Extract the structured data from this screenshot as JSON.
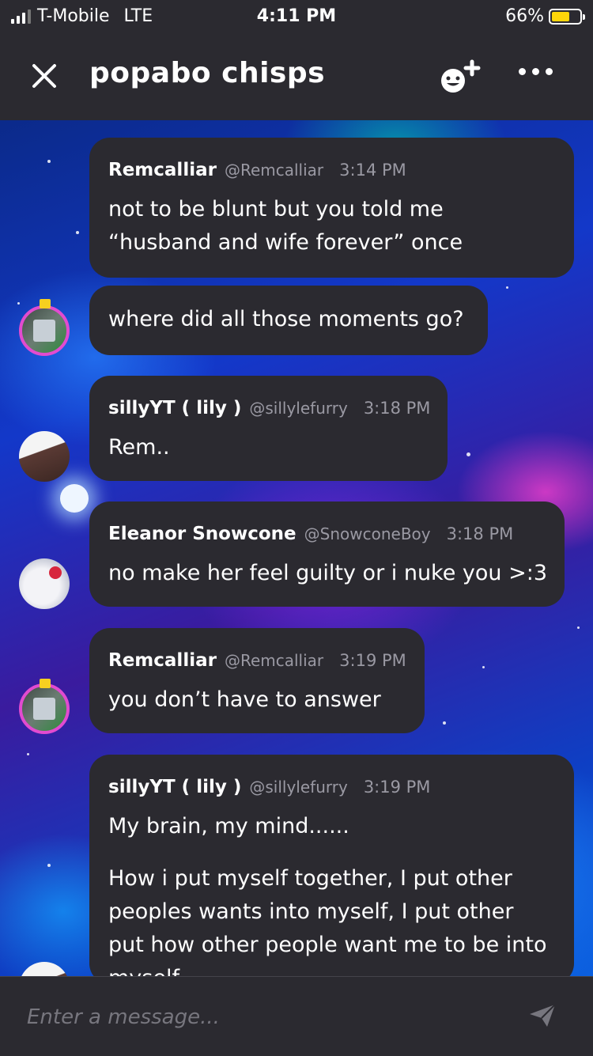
{
  "status_bar": {
    "carrier": "T-Mobile",
    "network": "LTE",
    "time": "4:11 PM",
    "battery": "66%"
  },
  "header": {
    "title": "popabo chisps"
  },
  "messages": [
    {
      "name": "Remcalliar",
      "handle": "@Remcalliar",
      "time": "3:14 PM",
      "text": "not to be blunt but you told me\n“husband and wife forever” once"
    },
    {
      "text": "where did all those moments go?"
    },
    {
      "name": "sillyYT ( lily )",
      "handle": "@sillylefurry",
      "time": "3:18 PM",
      "text": "Rem.."
    },
    {
      "name": "Eleanor Snowcone",
      "handle": "@SnowconeBoy",
      "time": "3:18 PM",
      "text": "no make her feel guilty or i nuke you >:3"
    },
    {
      "name": "Remcalliar",
      "handle": "@Remcalliar",
      "time": "3:19 PM",
      "text": "you don’t have to answer"
    },
    {
      "name": "sillyYT ( lily )",
      "handle": "@sillylefurry",
      "time": "3:19 PM",
      "text": "My brain, my mind......",
      "text2": "How i put myself together, I put other\npeoples wants into myself, I put other\nput how other people want me to be into\nmyself"
    }
  ],
  "composer": {
    "placeholder": "Enter a message..."
  }
}
